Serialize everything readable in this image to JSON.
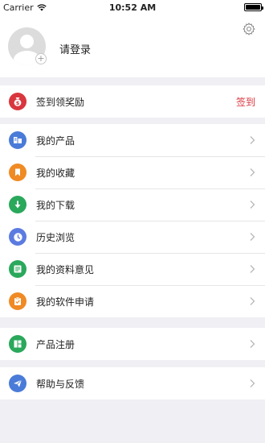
{
  "status_bar": {
    "carrier": "Carrier",
    "time": "10:52 AM"
  },
  "profile": {
    "login_text": "请登录",
    "avatar_plus": "+"
  },
  "checkin": {
    "label": "签到领奖励",
    "action": "签到",
    "icon_color": "#d9363e"
  },
  "menu": [
    {
      "label": "我的产品",
      "icon": "products-icon",
      "color": "#4a7bd8"
    },
    {
      "label": "我的收藏",
      "icon": "bookmark-icon",
      "color": "#f08a24"
    },
    {
      "label": "我的下载",
      "icon": "download-icon",
      "color": "#2aa85b"
    },
    {
      "label": "历史浏览",
      "icon": "clock-icon",
      "color": "#5b7be0"
    },
    {
      "label": "我的资料意见",
      "icon": "document-icon",
      "color": "#2aa85b"
    },
    {
      "label": "我的软件申请",
      "icon": "clipboard-icon",
      "color": "#f08a24"
    }
  ],
  "register": {
    "label": "产品注册",
    "icon": "grid-icon",
    "color": "#2aa85b"
  },
  "help": {
    "label": "帮助与反馈",
    "icon": "send-icon",
    "color": "#4a7bd8"
  }
}
